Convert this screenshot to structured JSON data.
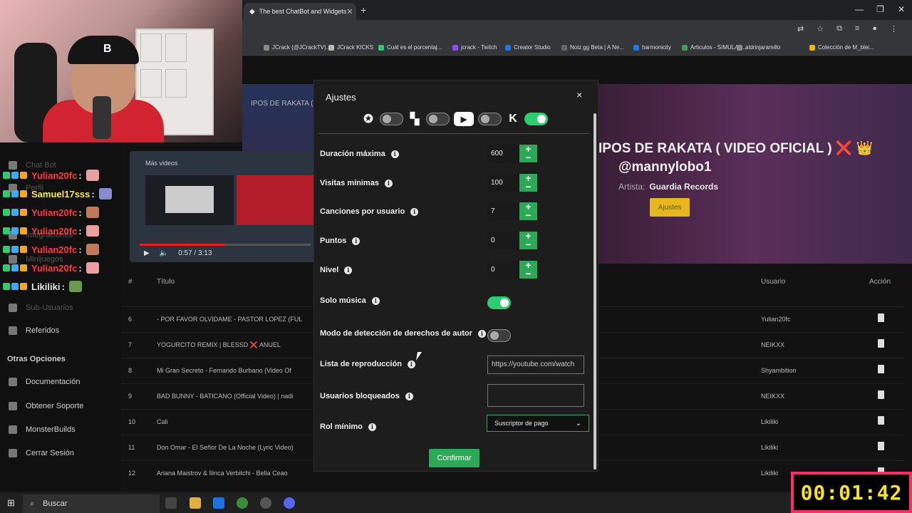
{
  "browser": {
    "tab_title": "The best ChatBot and Widgets",
    "bookmarks": [
      {
        "label": "JCrack (@JCrackTV)...",
        "color": "#888"
      },
      {
        "label": "JCrack KICKS",
        "color": "#bbb"
      },
      {
        "label": "Cuál es el porcentaj...",
        "color": "#2ecc71"
      },
      {
        "label": "jcrack - Twitch",
        "color": "#9146ff"
      },
      {
        "label": "Creator Studio",
        "color": "#1877f2"
      },
      {
        "label": "Noiz.gg Beta | A Ne...",
        "color": "#666"
      },
      {
        "label": "harmonicity",
        "color": "#1877f2"
      },
      {
        "label": "Articulos - SIMULAC...",
        "color": "#3ea055"
      },
      {
        "label": "aldrinjaramillo",
        "color": "#888"
      },
      {
        "label": "Colección de M_blei...",
        "color": "#f4b400"
      }
    ]
  },
  "sidebar": {
    "items": [
      "Chat Bot",
      "Perfil",
      "Integraciones",
      "Minijuegos",
      "Sub-Usuarios",
      "Referidos"
    ],
    "other_heading": "Otras Opciones",
    "other_items": [
      "Documentación",
      "Obtener Soporte",
      "MonsterBuilds",
      "Cerrar Sesión"
    ]
  },
  "chat": [
    {
      "user": "Yulian20fc",
      "color": "#ff3b3b"
    },
    {
      "user": "Samuel17sss",
      "color": "#ffe74a"
    },
    {
      "user": "Yulian20fc",
      "color": "#ff3b3b"
    },
    {
      "user": "Yulian20fc",
      "color": "#ff3b3b"
    },
    {
      "user": "Yulian20fc",
      "color": "#ff3b3b"
    },
    {
      "user": "Yulian20fc",
      "color": "#ff3b3b"
    },
    {
      "user": "Likiliki",
      "color": "#e8e8e8"
    }
  ],
  "video": {
    "more_videos": "Más videos",
    "time": "0:57 / 3:13",
    "left_title": "IPOS DE RAKATA ( V"
  },
  "hero": {
    "title": "IPOS DE RAKATA ( VIDEO OFICIAL ) ❌ 👑",
    "user": "@mannylobo1",
    "artist_label": "Artista:",
    "artist": "Guardia Records",
    "settings_btn": "Ajustes"
  },
  "table": {
    "headers": {
      "num": "#",
      "title": "Título",
      "user": "Usuario",
      "action": "Acción"
    },
    "rows": [
      {
        "n": "6",
        "title": "- POR FAVOR OLVIDAME - PASTOR LOPEZ (FUL",
        "user": "Yulian20fc"
      },
      {
        "n": "7",
        "title": "YOGURCITO REMIX | BLESSD ❌ ANUEL",
        "user": "NEIKXX"
      },
      {
        "n": "8",
        "title": "Mi Gran Secreto - Fernando Burbano (Video Of",
        "user": "Shyambition"
      },
      {
        "n": "9",
        "title": "BAD BUNNY - BATICANO (Official Video) | nadi",
        "user": "NEIKXX"
      },
      {
        "n": "10",
        "title": "Cali",
        "user": "Likiliki"
      },
      {
        "n": "11",
        "title": "Don Omar - El Señor De La Noche (Lyric Video)",
        "user": "Likiliki"
      },
      {
        "n": "12",
        "title": "Ariana Maistrov & Ilinca Verbitchi - Bella Ceao",
        "user": "Likiliki"
      }
    ]
  },
  "modal": {
    "title": "Ajustes",
    "close": "×",
    "platforms": [
      {
        "name": "kick-alt",
        "on": false
      },
      {
        "name": "twitch",
        "on": false
      },
      {
        "name": "youtube",
        "on": false
      },
      {
        "name": "kick",
        "on": true
      }
    ],
    "fields": {
      "max_duration": {
        "label": "Duración máxima",
        "value": "600"
      },
      "min_views": {
        "label": "Visitas mínimas",
        "value": "100"
      },
      "songs_per_user": {
        "label": "Canciones por usuario",
        "value": "7"
      },
      "points": {
        "label": "Puntos",
        "value": "0"
      },
      "level": {
        "label": "Nivel",
        "value": "0"
      }
    },
    "music_only": {
      "label": "Solo música",
      "on": true
    },
    "copyright_mode": {
      "label": "Modo de detección de derechos de autor",
      "on": false
    },
    "playlist": {
      "label": "Lista de reproducción",
      "value": "https://youtube.com/watch"
    },
    "blocked_users": {
      "label": "Usuarios bloqueados",
      "value": ""
    },
    "min_role": {
      "label": "Rol mínimo",
      "value": "Suscriptor de pago"
    },
    "confirm": "Confirmar"
  },
  "taskbar": {
    "search_placeholder": "Buscar"
  },
  "timer": "00:01:42"
}
